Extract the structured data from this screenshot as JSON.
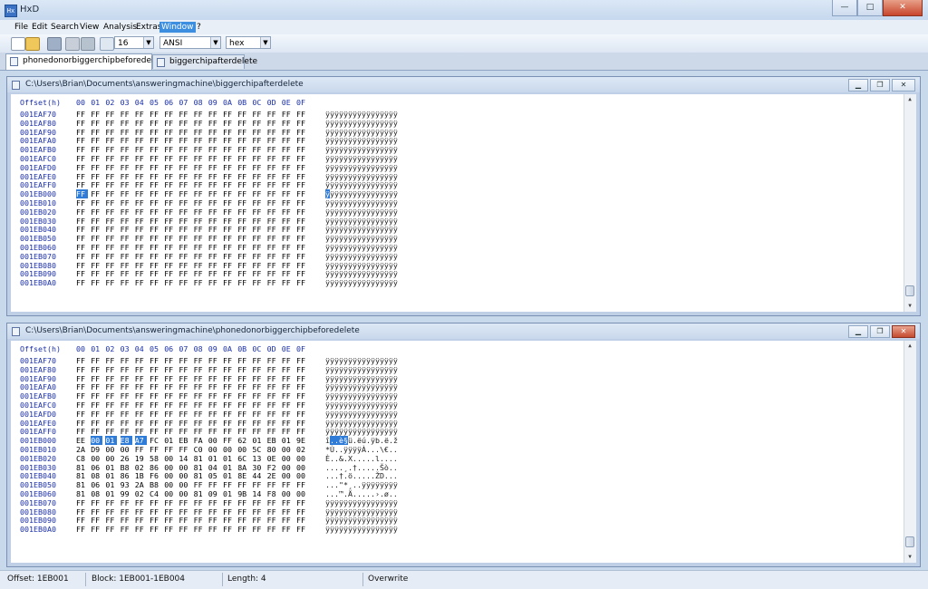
{
  "app": {
    "title": "HxD"
  },
  "window_buttons": {
    "minimize": "—",
    "maximize": "□",
    "close": "✕"
  },
  "menu": [
    "File",
    "Edit",
    "Search",
    "View",
    "Analysis",
    "Extras",
    "Window",
    "?"
  ],
  "menu_active": "Window",
  "toolbar": {
    "bytes_per_row": "16",
    "charset": "ANSI",
    "offset_base": "hex",
    "icons": [
      "new-file-icon",
      "open-file-icon",
      "save-icon",
      "print-icon",
      "settings-icon",
      "columns-icon"
    ]
  },
  "tabs": [
    {
      "label": "phonedonorbiggerchipbeforedelete",
      "active": true
    },
    {
      "label": "biggerchipafterdelete",
      "active": false
    }
  ],
  "panels": [
    {
      "path": "C:\\Users\\Brian\\Documents\\answeringmachine\\biggerchipafterdelete",
      "header_offset": "Offset(h)",
      "header_cols": [
        "00",
        "01",
        "02",
        "03",
        "04",
        "05",
        "06",
        "07",
        "08",
        "09",
        "0A",
        "0B",
        "0C",
        "0D",
        "0E",
        "0F"
      ],
      "rows": [
        {
          "offset": "001EAF70",
          "bytes": [
            "FF",
            "FF",
            "FF",
            "FF",
            "FF",
            "FF",
            "FF",
            "FF",
            "FF",
            "FF",
            "FF",
            "FF",
            "FF",
            "FF",
            "FF",
            "FF"
          ],
          "ascii": "ÿÿÿÿÿÿÿÿÿÿÿÿÿÿÿÿ"
        },
        {
          "offset": "001EAF80",
          "bytes": [
            "FF",
            "FF",
            "FF",
            "FF",
            "FF",
            "FF",
            "FF",
            "FF",
            "FF",
            "FF",
            "FF",
            "FF",
            "FF",
            "FF",
            "FF",
            "FF"
          ],
          "ascii": "ÿÿÿÿÿÿÿÿÿÿÿÿÿÿÿÿ"
        },
        {
          "offset": "001EAF90",
          "bytes": [
            "FF",
            "FF",
            "FF",
            "FF",
            "FF",
            "FF",
            "FF",
            "FF",
            "FF",
            "FF",
            "FF",
            "FF",
            "FF",
            "FF",
            "FF",
            "FF"
          ],
          "ascii": "ÿÿÿÿÿÿÿÿÿÿÿÿÿÿÿÿ"
        },
        {
          "offset": "001EAFA0",
          "bytes": [
            "FF",
            "FF",
            "FF",
            "FF",
            "FF",
            "FF",
            "FF",
            "FF",
            "FF",
            "FF",
            "FF",
            "FF",
            "FF",
            "FF",
            "FF",
            "FF"
          ],
          "ascii": "ÿÿÿÿÿÿÿÿÿÿÿÿÿÿÿÿ"
        },
        {
          "offset": "001EAFB0",
          "bytes": [
            "FF",
            "FF",
            "FF",
            "FF",
            "FF",
            "FF",
            "FF",
            "FF",
            "FF",
            "FF",
            "FF",
            "FF",
            "FF",
            "FF",
            "FF",
            "FF"
          ],
          "ascii": "ÿÿÿÿÿÿÿÿÿÿÿÿÿÿÿÿ"
        },
        {
          "offset": "001EAFC0",
          "bytes": [
            "FF",
            "FF",
            "FF",
            "FF",
            "FF",
            "FF",
            "FF",
            "FF",
            "FF",
            "FF",
            "FF",
            "FF",
            "FF",
            "FF",
            "FF",
            "FF"
          ],
          "ascii": "ÿÿÿÿÿÿÿÿÿÿÿÿÿÿÿÿ"
        },
        {
          "offset": "001EAFD0",
          "bytes": [
            "FF",
            "FF",
            "FF",
            "FF",
            "FF",
            "FF",
            "FF",
            "FF",
            "FF",
            "FF",
            "FF",
            "FF",
            "FF",
            "FF",
            "FF",
            "FF"
          ],
          "ascii": "ÿÿÿÿÿÿÿÿÿÿÿÿÿÿÿÿ"
        },
        {
          "offset": "001EAFE0",
          "bytes": [
            "FF",
            "FF",
            "FF",
            "FF",
            "FF",
            "FF",
            "FF",
            "FF",
            "FF",
            "FF",
            "FF",
            "FF",
            "FF",
            "FF",
            "FF",
            "FF"
          ],
          "ascii": "ÿÿÿÿÿÿÿÿÿÿÿÿÿÿÿÿ"
        },
        {
          "offset": "001EAFF0",
          "bytes": [
            "FF",
            "FF",
            "FF",
            "FF",
            "FF",
            "FF",
            "FF",
            "FF",
            "FF",
            "FF",
            "FF",
            "FF",
            "FF",
            "FF",
            "FF",
            "FF"
          ],
          "ascii": "ÿÿÿÿÿÿÿÿÿÿÿÿÿÿÿÿ"
        },
        {
          "offset": "001EB000",
          "bytes": [
            "FF",
            "FF",
            "FF",
            "FF",
            "FF",
            "FF",
            "FF",
            "FF",
            "FF",
            "FF",
            "FF",
            "FF",
            "FF",
            "FF",
            "FF",
            "FF"
          ],
          "ascii": "ÿÿÿÿÿÿÿÿÿÿÿÿÿÿÿÿ",
          "sel": [
            0
          ],
          "asel": [
            0
          ]
        },
        {
          "offset": "001EB010",
          "bytes": [
            "FF",
            "FF",
            "FF",
            "FF",
            "FF",
            "FF",
            "FF",
            "FF",
            "FF",
            "FF",
            "FF",
            "FF",
            "FF",
            "FF",
            "FF",
            "FF"
          ],
          "ascii": "ÿÿÿÿÿÿÿÿÿÿÿÿÿÿÿÿ"
        },
        {
          "offset": "001EB020",
          "bytes": [
            "FF",
            "FF",
            "FF",
            "FF",
            "FF",
            "FF",
            "FF",
            "FF",
            "FF",
            "FF",
            "FF",
            "FF",
            "FF",
            "FF",
            "FF",
            "FF"
          ],
          "ascii": "ÿÿÿÿÿÿÿÿÿÿÿÿÿÿÿÿ"
        },
        {
          "offset": "001EB030",
          "bytes": [
            "FF",
            "FF",
            "FF",
            "FF",
            "FF",
            "FF",
            "FF",
            "FF",
            "FF",
            "FF",
            "FF",
            "FF",
            "FF",
            "FF",
            "FF",
            "FF"
          ],
          "ascii": "ÿÿÿÿÿÿÿÿÿÿÿÿÿÿÿÿ"
        },
        {
          "offset": "001EB040",
          "bytes": [
            "FF",
            "FF",
            "FF",
            "FF",
            "FF",
            "FF",
            "FF",
            "FF",
            "FF",
            "FF",
            "FF",
            "FF",
            "FF",
            "FF",
            "FF",
            "FF"
          ],
          "ascii": "ÿÿÿÿÿÿÿÿÿÿÿÿÿÿÿÿ"
        },
        {
          "offset": "001EB050",
          "bytes": [
            "FF",
            "FF",
            "FF",
            "FF",
            "FF",
            "FF",
            "FF",
            "FF",
            "FF",
            "FF",
            "FF",
            "FF",
            "FF",
            "FF",
            "FF",
            "FF"
          ],
          "ascii": "ÿÿÿÿÿÿÿÿÿÿÿÿÿÿÿÿ"
        },
        {
          "offset": "001EB060",
          "bytes": [
            "FF",
            "FF",
            "FF",
            "FF",
            "FF",
            "FF",
            "FF",
            "FF",
            "FF",
            "FF",
            "FF",
            "FF",
            "FF",
            "FF",
            "FF",
            "FF"
          ],
          "ascii": "ÿÿÿÿÿÿÿÿÿÿÿÿÿÿÿÿ"
        },
        {
          "offset": "001EB070",
          "bytes": [
            "FF",
            "FF",
            "FF",
            "FF",
            "FF",
            "FF",
            "FF",
            "FF",
            "FF",
            "FF",
            "FF",
            "FF",
            "FF",
            "FF",
            "FF",
            "FF"
          ],
          "ascii": "ÿÿÿÿÿÿÿÿÿÿÿÿÿÿÿÿ"
        },
        {
          "offset": "001EB080",
          "bytes": [
            "FF",
            "FF",
            "FF",
            "FF",
            "FF",
            "FF",
            "FF",
            "FF",
            "FF",
            "FF",
            "FF",
            "FF",
            "FF",
            "FF",
            "FF",
            "FF"
          ],
          "ascii": "ÿÿÿÿÿÿÿÿÿÿÿÿÿÿÿÿ"
        },
        {
          "offset": "001EB090",
          "bytes": [
            "FF",
            "FF",
            "FF",
            "FF",
            "FF",
            "FF",
            "FF",
            "FF",
            "FF",
            "FF",
            "FF",
            "FF",
            "FF",
            "FF",
            "FF",
            "FF"
          ],
          "ascii": "ÿÿÿÿÿÿÿÿÿÿÿÿÿÿÿÿ"
        },
        {
          "offset": "001EB0A0",
          "bytes": [
            "FF",
            "FF",
            "FF",
            "FF",
            "FF",
            "FF",
            "FF",
            "FF",
            "FF",
            "FF",
            "FF",
            "FF",
            "FF",
            "FF",
            "FF",
            "FF"
          ],
          "ascii": "ÿÿÿÿÿÿÿÿÿÿÿÿÿÿÿÿ"
        }
      ]
    },
    {
      "path": "C:\\Users\\Brian\\Documents\\answeringmachine\\phonedonorbiggerchipbeforedelete",
      "header_offset": "Offset(h)",
      "header_cols": [
        "00",
        "01",
        "02",
        "03",
        "04",
        "05",
        "06",
        "07",
        "08",
        "09",
        "0A",
        "0B",
        "0C",
        "0D",
        "0E",
        "0F"
      ],
      "rows": [
        {
          "offset": "001EAF70",
          "bytes": [
            "FF",
            "FF",
            "FF",
            "FF",
            "FF",
            "FF",
            "FF",
            "FF",
            "FF",
            "FF",
            "FF",
            "FF",
            "FF",
            "FF",
            "FF",
            "FF"
          ],
          "ascii": "ÿÿÿÿÿÿÿÿÿÿÿÿÿÿÿÿ"
        },
        {
          "offset": "001EAF80",
          "bytes": [
            "FF",
            "FF",
            "FF",
            "FF",
            "FF",
            "FF",
            "FF",
            "FF",
            "FF",
            "FF",
            "FF",
            "FF",
            "FF",
            "FF",
            "FF",
            "FF"
          ],
          "ascii": "ÿÿÿÿÿÿÿÿÿÿÿÿÿÿÿÿ"
        },
        {
          "offset": "001EAF90",
          "bytes": [
            "FF",
            "FF",
            "FF",
            "FF",
            "FF",
            "FF",
            "FF",
            "FF",
            "FF",
            "FF",
            "FF",
            "FF",
            "FF",
            "FF",
            "FF",
            "FF"
          ],
          "ascii": "ÿÿÿÿÿÿÿÿÿÿÿÿÿÿÿÿ"
        },
        {
          "offset": "001EAFA0",
          "bytes": [
            "FF",
            "FF",
            "FF",
            "FF",
            "FF",
            "FF",
            "FF",
            "FF",
            "FF",
            "FF",
            "FF",
            "FF",
            "FF",
            "FF",
            "FF",
            "FF"
          ],
          "ascii": "ÿÿÿÿÿÿÿÿÿÿÿÿÿÿÿÿ"
        },
        {
          "offset": "001EAFB0",
          "bytes": [
            "FF",
            "FF",
            "FF",
            "FF",
            "FF",
            "FF",
            "FF",
            "FF",
            "FF",
            "FF",
            "FF",
            "FF",
            "FF",
            "FF",
            "FF",
            "FF"
          ],
          "ascii": "ÿÿÿÿÿÿÿÿÿÿÿÿÿÿÿÿ"
        },
        {
          "offset": "001EAFC0",
          "bytes": [
            "FF",
            "FF",
            "FF",
            "FF",
            "FF",
            "FF",
            "FF",
            "FF",
            "FF",
            "FF",
            "FF",
            "FF",
            "FF",
            "FF",
            "FF",
            "FF"
          ],
          "ascii": "ÿÿÿÿÿÿÿÿÿÿÿÿÿÿÿÿ"
        },
        {
          "offset": "001EAFD0",
          "bytes": [
            "FF",
            "FF",
            "FF",
            "FF",
            "FF",
            "FF",
            "FF",
            "FF",
            "FF",
            "FF",
            "FF",
            "FF",
            "FF",
            "FF",
            "FF",
            "FF"
          ],
          "ascii": "ÿÿÿÿÿÿÿÿÿÿÿÿÿÿÿÿ"
        },
        {
          "offset": "001EAFE0",
          "bytes": [
            "FF",
            "FF",
            "FF",
            "FF",
            "FF",
            "FF",
            "FF",
            "FF",
            "FF",
            "FF",
            "FF",
            "FF",
            "FF",
            "FF",
            "FF",
            "FF"
          ],
          "ascii": "ÿÿÿÿÿÿÿÿÿÿÿÿÿÿÿÿ"
        },
        {
          "offset": "001EAFF0",
          "bytes": [
            "FF",
            "FF",
            "FF",
            "FF",
            "FF",
            "FF",
            "FF",
            "FF",
            "FF",
            "FF",
            "FF",
            "FF",
            "FF",
            "FF",
            "FF",
            "FF"
          ],
          "ascii": "ÿÿÿÿÿÿÿÿÿÿÿÿÿÿÿÿ"
        },
        {
          "offset": "001EB000",
          "bytes": [
            "EE",
            "00",
            "01",
            "E8",
            "A7",
            "FC",
            "01",
            "EB",
            "FA",
            "00",
            "FF",
            "62",
            "01",
            "EB",
            "01",
            "9E"
          ],
          "ascii": "î..è§ü.ëú.ÿb.ë.ž",
          "sel": [
            1,
            2,
            3,
            4
          ],
          "asel": [
            1,
            2,
            3,
            4
          ]
        },
        {
          "offset": "001EB010",
          "bytes": [
            "2A",
            "D9",
            "00",
            "00",
            "FF",
            "FF",
            "FF",
            "FF",
            "C0",
            "00",
            "00",
            "00",
            "5C",
            "80",
            "00",
            "02"
          ],
          "ascii": "*Ù..ÿÿÿÿÀ...\\€.."
        },
        {
          "offset": "001EB020",
          "bytes": [
            "C8",
            "00",
            "00",
            "26",
            "19",
            "58",
            "00",
            "14",
            "81",
            "01",
            "01",
            "6C",
            "13",
            "0E",
            "00",
            "00"
          ],
          "ascii": "È..&.X.....l...."
        },
        {
          "offset": "001EB030",
          "bytes": [
            "81",
            "06",
            "01",
            "B8",
            "02",
            "86",
            "00",
            "00",
            "81",
            "04",
            "01",
            "8A",
            "30",
            "F2",
            "00",
            "00"
          ],
          "ascii": "....¸.†.....Šò.."
        },
        {
          "offset": "001EB040",
          "bytes": [
            "81",
            "08",
            "01",
            "86",
            "1B",
            "F6",
            "00",
            "00",
            "81",
            "05",
            "01",
            "8E",
            "44",
            "2E",
            "00",
            "00"
          ],
          "ascii": "...†.ö.....ŽD..."
        },
        {
          "offset": "001EB050",
          "bytes": [
            "81",
            "06",
            "01",
            "93",
            "2A",
            "B8",
            "00",
            "00",
            "FF",
            "FF",
            "FF",
            "FF",
            "FF",
            "FF",
            "FF",
            "FF"
          ],
          "ascii": "...\"*¸..ÿÿÿÿÿÿÿÿ"
        },
        {
          "offset": "001EB060",
          "bytes": [
            "81",
            "08",
            "01",
            "99",
            "02",
            "C4",
            "00",
            "00",
            "81",
            "09",
            "01",
            "9B",
            "14",
            "F8",
            "00",
            "00"
          ],
          "ascii": "...™.Ä.....›.ø.."
        },
        {
          "offset": "001EB070",
          "bytes": [
            "FF",
            "FF",
            "FF",
            "FF",
            "FF",
            "FF",
            "FF",
            "FF",
            "FF",
            "FF",
            "FF",
            "FF",
            "FF",
            "FF",
            "FF",
            "FF"
          ],
          "ascii": "ÿÿÿÿÿÿÿÿÿÿÿÿÿÿÿÿ"
        },
        {
          "offset": "001EB080",
          "bytes": [
            "FF",
            "FF",
            "FF",
            "FF",
            "FF",
            "FF",
            "FF",
            "FF",
            "FF",
            "FF",
            "FF",
            "FF",
            "FF",
            "FF",
            "FF",
            "FF"
          ],
          "ascii": "ÿÿÿÿÿÿÿÿÿÿÿÿÿÿÿÿ"
        },
        {
          "offset": "001EB090",
          "bytes": [
            "FF",
            "FF",
            "FF",
            "FF",
            "FF",
            "FF",
            "FF",
            "FF",
            "FF",
            "FF",
            "FF",
            "FF",
            "FF",
            "FF",
            "FF",
            "FF"
          ],
          "ascii": "ÿÿÿÿÿÿÿÿÿÿÿÿÿÿÿÿ"
        },
        {
          "offset": "001EB0A0",
          "bytes": [
            "FF",
            "FF",
            "FF",
            "FF",
            "FF",
            "FF",
            "FF",
            "FF",
            "FF",
            "FF",
            "FF",
            "FF",
            "FF",
            "FF",
            "FF",
            "FF"
          ],
          "ascii": "ÿÿÿÿÿÿÿÿÿÿÿÿÿÿÿÿ"
        }
      ]
    }
  ],
  "status": {
    "offset": "Offset: 1EB001",
    "block": "Block: 1EB001-1EB004",
    "length": "Length: 4",
    "mode": "Overwrite"
  },
  "colors": {
    "offset_text": "#1a2fa8",
    "selection": "#2f7bd8"
  }
}
